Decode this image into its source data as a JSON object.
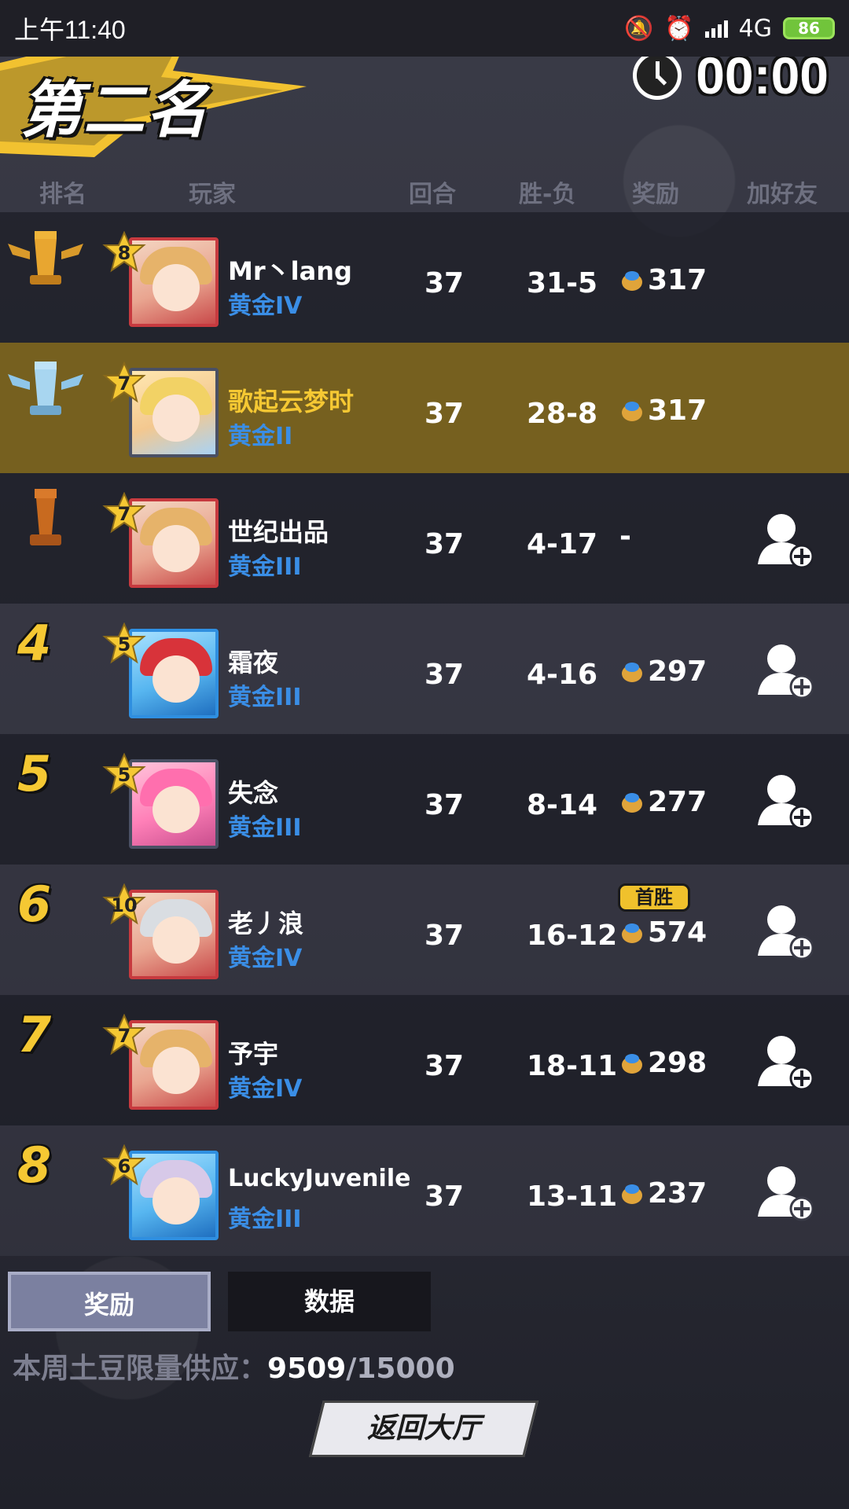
{
  "status_bar": {
    "time": "上午11:40",
    "network": "4G",
    "battery": "86"
  },
  "header": {
    "rank_title": "第二名",
    "timer": "00:00"
  },
  "columns": {
    "rank": "排名",
    "player": "玩家",
    "rounds": "回合",
    "win_loss": "胜-负",
    "reward": "奖励",
    "add_friend": "加好友"
  },
  "players": [
    {
      "rank": "1",
      "level": "8",
      "name": "Mr丶lang",
      "tier": "黄金IV",
      "rounds": "37",
      "win_loss": "31-5",
      "reward": "317",
      "add_friend": false,
      "self": false
    },
    {
      "rank": "2",
      "level": "7",
      "name": "歌起云梦时",
      "tier": "黄金II",
      "rounds": "37",
      "win_loss": "28-8",
      "reward": "317",
      "add_friend": false,
      "self": true
    },
    {
      "rank": "3",
      "level": "7",
      "name": "世纪出品",
      "tier": "黄金III",
      "rounds": "37",
      "win_loss": "4-17",
      "reward": "-",
      "add_friend": true,
      "self": false
    },
    {
      "rank": "4",
      "level": "5",
      "name": "霜夜",
      "tier": "黄金III",
      "rounds": "37",
      "win_loss": "4-16",
      "reward": "297",
      "add_friend": true,
      "self": false
    },
    {
      "rank": "5",
      "level": "5",
      "name": "失念",
      "tier": "黄金III",
      "rounds": "37",
      "win_loss": "8-14",
      "reward": "277",
      "add_friend": true,
      "self": false
    },
    {
      "rank": "6",
      "level": "10",
      "name": "老丿浪",
      "tier": "黄金IV",
      "rounds": "37",
      "win_loss": "16-12",
      "reward": "574",
      "badge": "首胜",
      "add_friend": true,
      "self": false
    },
    {
      "rank": "7",
      "level": "7",
      "name": "予宇",
      "tier": "黄金IV",
      "rounds": "37",
      "win_loss": "18-11",
      "reward": "298",
      "add_friend": true,
      "self": false
    },
    {
      "rank": "8",
      "level": "6",
      "name": "LuckyJuvenile",
      "tier": "黄金III",
      "rounds": "37",
      "win_loss": "13-11",
      "reward": "237",
      "add_friend": true,
      "self": false
    }
  ],
  "tabs": {
    "reward": "奖励",
    "data": "数据"
  },
  "supply": {
    "label": "本周土豆限量供应：",
    "current": "9509",
    "separator": "/",
    "max": "15000"
  },
  "back_button": "返回大厅",
  "colors": {
    "gold_text": "#f5c833",
    "tier_blue": "#3a8ee6",
    "self_row": "#76601f"
  }
}
